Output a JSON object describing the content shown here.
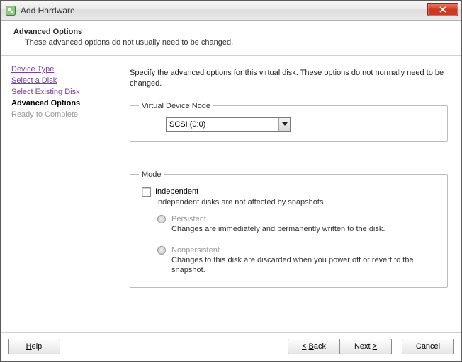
{
  "window": {
    "title": "Add Hardware"
  },
  "header": {
    "title": "Advanced Options",
    "subtitle": "These advanced options do not usually need to be changed."
  },
  "sidebar": {
    "steps": {
      "device_type": "Device Type",
      "select_disk": "Select a Disk",
      "select_existing": "Select Existing Disk",
      "advanced": "Advanced Options",
      "ready": "Ready to Complete"
    }
  },
  "main": {
    "intro": "Specify the advanced options for this virtual disk. These options do not normally need to be changed.",
    "vdn": {
      "legend": "Virtual Device Node",
      "value": "SCSI (0:0)"
    },
    "mode": {
      "legend": "Mode",
      "independent_label": "Independent",
      "independent_desc": "Independent disks are not affected by snapshots.",
      "persistent_label": "Persistent",
      "persistent_desc": "Changes are immediately and permanently written to the disk.",
      "nonpersistent_label": "Nonpersistent",
      "nonpersistent_desc": "Changes to this disk are discarded when you power off or revert to the snapshot."
    }
  },
  "footer": {
    "help": "Help",
    "back": "Back",
    "next": "Next",
    "cancel": "Cancel"
  }
}
